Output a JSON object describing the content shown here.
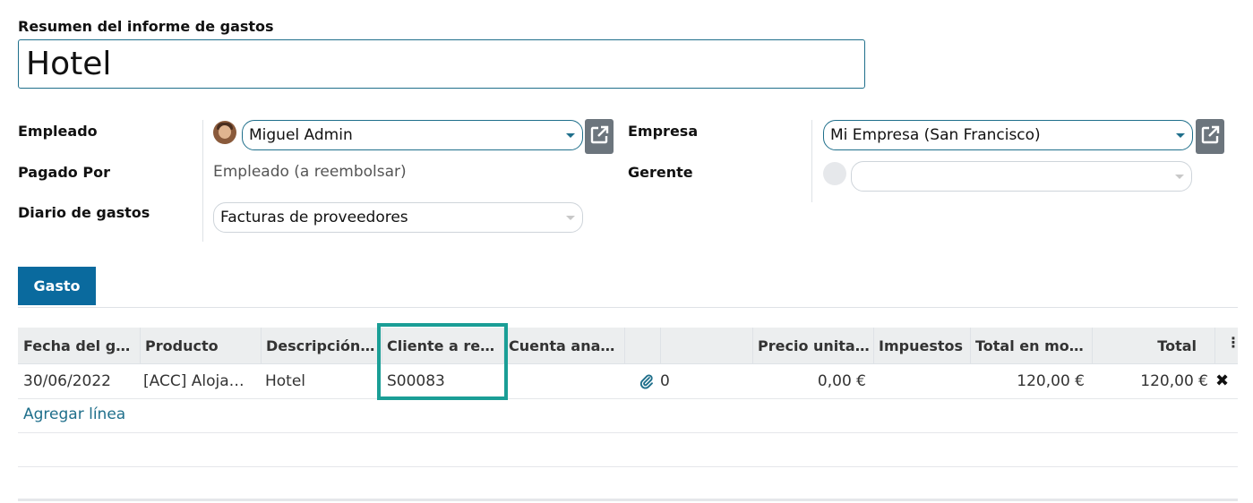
{
  "form": {
    "summary_label": "Resumen del informe de gastos",
    "summary_value": "Hotel",
    "employee_label": "Empleado",
    "employee_value": "Miguel Admin",
    "paid_by_label": "Pagado Por",
    "paid_by_value": "Empleado (a reembolsar)",
    "journal_label": "Diario de gastos",
    "journal_value": "Facturas de proveedores",
    "company_label": "Empresa",
    "company_value": "Mi Empresa (San Francisco)",
    "manager_label": "Gerente",
    "manager_value": ""
  },
  "tabs": [
    {
      "label": "Gasto"
    }
  ],
  "table": {
    "columns": [
      "Fecha del g…",
      "Producto",
      "Descripción…",
      "Cliente a re…",
      "Cuenta ana…",
      "",
      "",
      "Precio unita…",
      "Impuestos",
      "Total en mo…",
      "Total"
    ],
    "rows": [
      {
        "date": "30/06/2022",
        "product": "[ACC] Aloja…",
        "description": "Hotel",
        "customer": "S00083",
        "analytic": "",
        "attachments": "0",
        "unit_price": "0,00 €",
        "taxes": "",
        "total_currency": "120,00 €",
        "total": "120,00 €"
      }
    ],
    "add_line_label": "Agregar línea"
  },
  "icons": {
    "external_link": "external-link-icon",
    "attachment": "paperclip-icon",
    "delete": "close-icon",
    "options": "kebab-menu-icon"
  },
  "colors": {
    "primary": "#0a6a9e",
    "link": "#1f6f8b",
    "highlight": "#1a9e96"
  }
}
